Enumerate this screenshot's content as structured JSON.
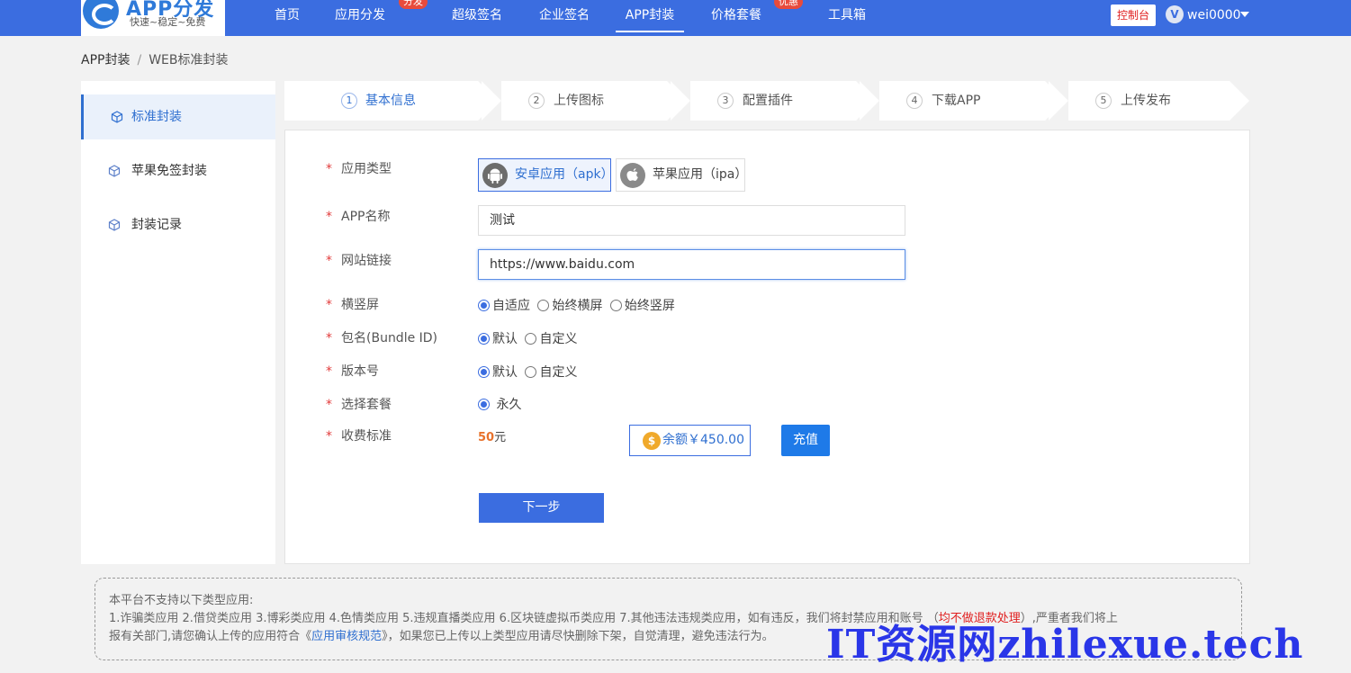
{
  "brand": {
    "name": "APP分发",
    "tagline": "快速~稳定~免费"
  },
  "nav": {
    "items": [
      {
        "label": "首页"
      },
      {
        "label": "应用分发",
        "badge": "分发"
      },
      {
        "label": "超级签名"
      },
      {
        "label": "企业签名"
      },
      {
        "label": "APP封装",
        "active": true
      },
      {
        "label": "价格套餐",
        "badge": "优惠"
      },
      {
        "label": "工具箱"
      }
    ],
    "console_label": "控制台",
    "user": {
      "avatar_letter": "V",
      "name": "wei0000"
    }
  },
  "breadcrumb": {
    "root": "APP封装",
    "separator": "/",
    "current": "WEB标准封装"
  },
  "sidebar": {
    "items": [
      {
        "label": "标准封装",
        "active": true,
        "icon": "cube-icon"
      },
      {
        "label": "苹果免签封装",
        "icon": "cube-icon"
      },
      {
        "label": "封装记录",
        "icon": "cube-icon"
      }
    ]
  },
  "steps": [
    {
      "num": "1",
      "label": "基本信息",
      "active": true
    },
    {
      "num": "2",
      "label": "上传图标"
    },
    {
      "num": "3",
      "label": "配置插件"
    },
    {
      "num": "4",
      "label": "下载APP"
    },
    {
      "num": "5",
      "label": "上传发布"
    }
  ],
  "form": {
    "required_mark": "*",
    "app_type": {
      "label": "应用类型",
      "options": [
        {
          "label": "安卓应用（apk）",
          "icon": "android-icon",
          "selected": true
        },
        {
          "label": "苹果应用（ipa）",
          "icon": "apple-icon",
          "selected": false
        }
      ]
    },
    "app_name": {
      "label": "APP名称",
      "value": "测试"
    },
    "site_url": {
      "label": "网站链接",
      "value": "https://www.baidu.com"
    },
    "orientation": {
      "label": "横竖屏",
      "options": [
        {
          "label": "自适应",
          "checked": true
        },
        {
          "label": "始终横屏",
          "checked": false
        },
        {
          "label": "始终竖屏",
          "checked": false
        }
      ]
    },
    "bundle_id": {
      "label": "包名(Bundle ID)",
      "options": [
        {
          "label": "默认",
          "checked": true
        },
        {
          "label": "自定义",
          "checked": false
        }
      ]
    },
    "version": {
      "label": "版本号",
      "options": [
        {
          "label": "默认",
          "checked": true
        },
        {
          "label": "自定义",
          "checked": false
        }
      ]
    },
    "package": {
      "label": "选择套餐",
      "options": [
        {
          "label": "永久",
          "checked": true
        }
      ]
    },
    "fee": {
      "label": "收费标准",
      "amount": "50",
      "unit": "元",
      "balance": "余额￥450.00",
      "recharge_label": "充值"
    },
    "next_label": "下一步"
  },
  "notice": {
    "title": "本平台不支持以下类型应用:",
    "line1_a": "1.诈骗类应用 2.借贷类应用 3.博彩类应用 4.色情类应用 5.违规直播类应用 6.区块链虚拟币类应用 7.其他违法违规类应用，如有违反，我们将封禁应用和账号 （",
    "line1_red": "均不做退款处理",
    "line1_b": "）,严重者我们将上",
    "line2_a": "报有关部门,请您确认上传的应用符合《",
    "line2_link": "应用审核规范",
    "line2_b": "》，如果您已上传以上类型应用请尽快删除下架，自觉清理，避免违法行为。"
  },
  "watermark": "IT资源网zhilexue.tech",
  "colors": {
    "primary": "#3b6de0",
    "required": "#e23c3c",
    "price": "#e8722c",
    "coin": "#f0a92b"
  }
}
